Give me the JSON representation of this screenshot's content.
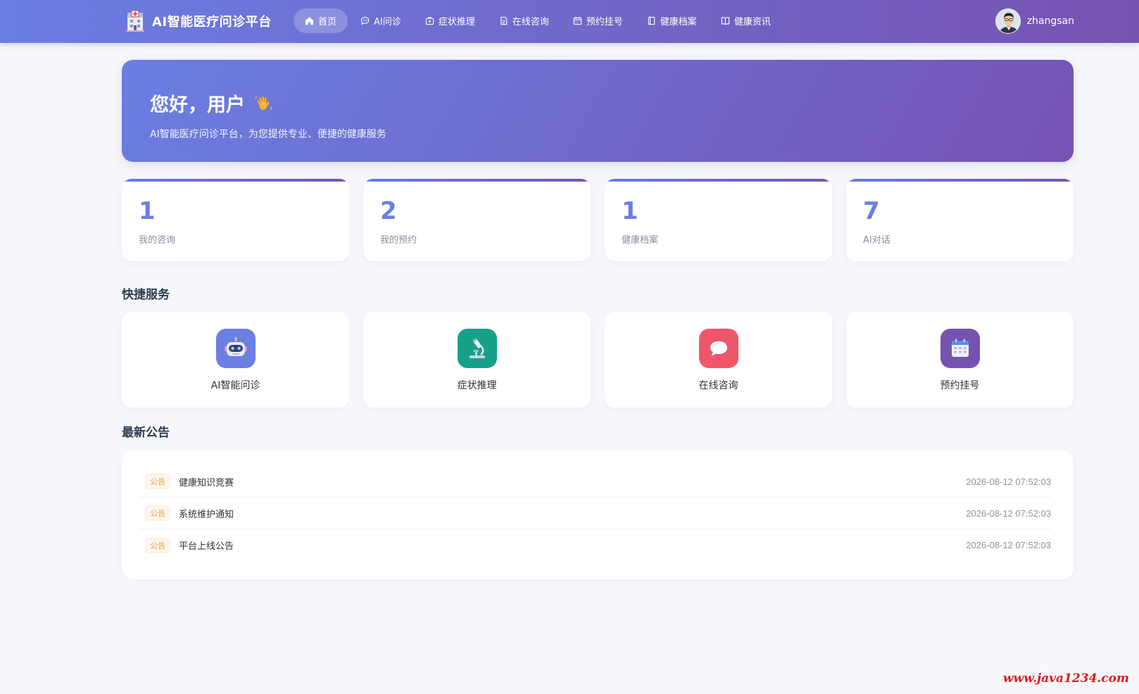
{
  "header": {
    "app_title": "AI智能医疗问诊平台",
    "nav": [
      {
        "label": "首页",
        "icon": "home-icon",
        "active": true
      },
      {
        "label": "AI问诊",
        "icon": "chat-bubble-icon",
        "active": false
      },
      {
        "label": "症状推理",
        "icon": "first-aid-icon",
        "active": false
      },
      {
        "label": "在线咨询",
        "icon": "document-icon",
        "active": false
      },
      {
        "label": "预约挂号",
        "icon": "calendar-icon",
        "active": false
      },
      {
        "label": "健康档案",
        "icon": "notebook-icon",
        "active": false
      },
      {
        "label": "健康资讯",
        "icon": "open-book-icon",
        "active": false
      }
    ],
    "username": "zhangsan"
  },
  "banner": {
    "greeting": "您好，用户",
    "subtitle": "AI智能医疗问诊平台，为您提供专业、便捷的健康服务"
  },
  "stats": [
    {
      "value": "1",
      "label": "我的咨询"
    },
    {
      "value": "2",
      "label": "我的预约"
    },
    {
      "value": "1",
      "label": "健康档案"
    },
    {
      "value": "7",
      "label": "AI对话"
    }
  ],
  "quick_services": {
    "title": "快捷服务",
    "items": [
      {
        "label": "AI智能问诊",
        "icon": "robot-icon",
        "color": "#6b7ee3"
      },
      {
        "label": "症状推理",
        "icon": "microscope-icon",
        "color": "#16a08a"
      },
      {
        "label": "在线咨询",
        "icon": "speech-bubble-icon",
        "color": "#f0566a"
      },
      {
        "label": "预约挂号",
        "icon": "calendar-icon",
        "color": "#7652b0"
      }
    ]
  },
  "announcements": {
    "title": "最新公告",
    "tag_label": "公告",
    "items": [
      {
        "title": "健康知识竞赛",
        "time": "2026-08-12 07:52:03"
      },
      {
        "title": "系统维护通知",
        "time": "2026-08-12 07:52:03"
      },
      {
        "title": "平台上线公告",
        "time": "2026-08-12 07:52:03"
      }
    ]
  },
  "watermark": "www.java1234.com",
  "colors": {
    "primary": "#6b7ee3",
    "secondary": "#7652b0",
    "tag": "#e6a23c"
  }
}
